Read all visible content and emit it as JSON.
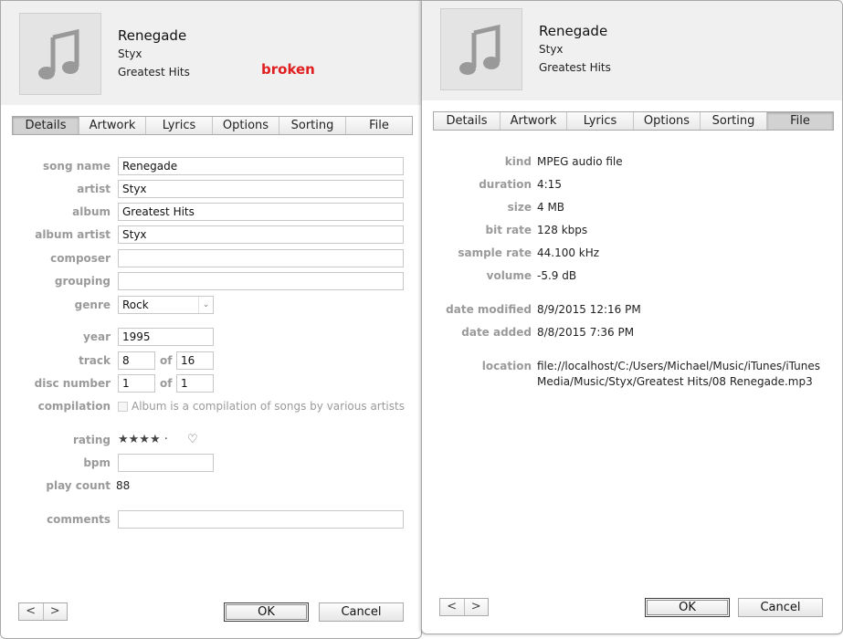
{
  "left": {
    "header": {
      "title": "Renegade",
      "artist": "Styx",
      "album": "Greatest Hits",
      "note": "broken"
    },
    "tabs": [
      "Details",
      "Artwork",
      "Lyrics",
      "Options",
      "Sorting",
      "File"
    ],
    "active_tab": "Details",
    "fields": {
      "song_name": {
        "label": "song name",
        "value": "Renegade"
      },
      "artist": {
        "label": "artist",
        "value": "Styx"
      },
      "album": {
        "label": "album",
        "value": "Greatest Hits"
      },
      "album_artist": {
        "label": "album artist",
        "value": "Styx"
      },
      "composer": {
        "label": "composer",
        "value": ""
      },
      "grouping": {
        "label": "grouping",
        "value": ""
      },
      "genre": {
        "label": "genre",
        "value": "Rock"
      },
      "year": {
        "label": "year",
        "value": "1995"
      },
      "track": {
        "label": "track",
        "value": "8",
        "of_label": "of",
        "of_value": "16"
      },
      "disc": {
        "label": "disc number",
        "value": "1",
        "of_label": "of",
        "of_value": "1"
      },
      "compilation": {
        "label": "compilation",
        "text": "Album is a compilation of songs by various artists",
        "checked": false
      },
      "rating": {
        "label": "rating",
        "stars": "★★★★ ·",
        "stars_value": 4,
        "heart": "♡"
      },
      "bpm": {
        "label": "bpm",
        "value": ""
      },
      "play_count": {
        "label": "play count",
        "value": "88"
      },
      "comments": {
        "label": "comments",
        "value": ""
      }
    },
    "footer": {
      "prev": "<",
      "next": ">",
      "ok": "OK",
      "cancel": "Cancel"
    }
  },
  "right": {
    "header": {
      "title": "Renegade",
      "artist": "Styx",
      "album": "Greatest Hits"
    },
    "tabs": [
      "Details",
      "Artwork",
      "Lyrics",
      "Options",
      "Sorting",
      "File"
    ],
    "active_tab": "File",
    "file_info": {
      "kind": {
        "label": "kind",
        "value": "MPEG audio file"
      },
      "duration": {
        "label": "duration",
        "value": "4:15"
      },
      "size": {
        "label": "size",
        "value": "4 MB"
      },
      "bit_rate": {
        "label": "bit rate",
        "value": "128 kbps"
      },
      "sample_rate": {
        "label": "sample rate",
        "value": "44.100 kHz"
      },
      "volume": {
        "label": "volume",
        "value": "-5.9 dB"
      },
      "date_modified": {
        "label": "date modified",
        "value": "8/9/2015 12:16 PM"
      },
      "date_added": {
        "label": "date added",
        "value": "8/8/2015 7:36 PM"
      },
      "location": {
        "label": "location",
        "line1": "file://localhost/C:/Users/Michael/Music/iTunes/iTunes",
        "line2": "Media/Music/Styx/Greatest Hits/08 Renegade.mp3"
      }
    },
    "footer": {
      "prev": "<",
      "next": ">",
      "ok": "OK",
      "cancel": "Cancel"
    }
  },
  "colors": {
    "note_red": "#e02020",
    "label_gray": "#9a9a9a",
    "header_bg": "#f0f0f0"
  }
}
